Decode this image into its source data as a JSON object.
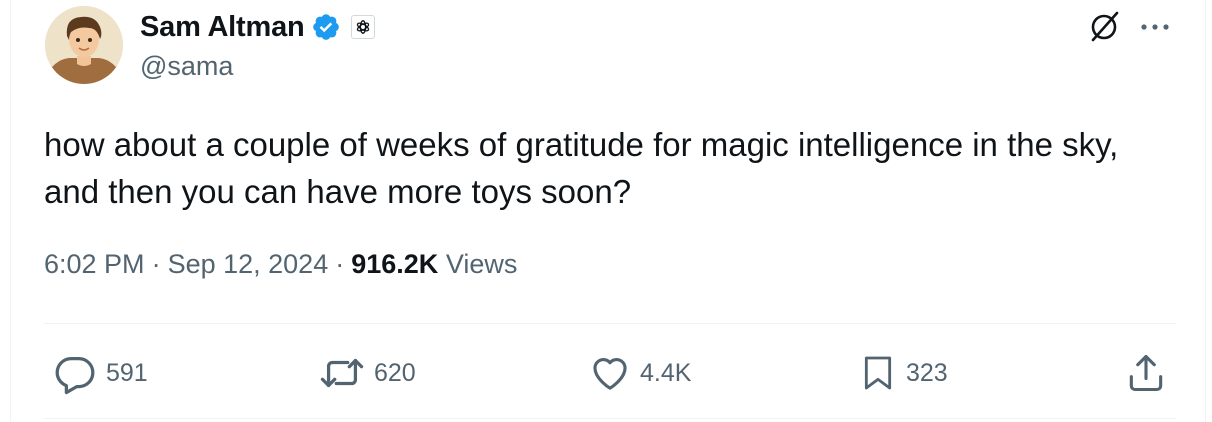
{
  "author": {
    "display_name": "Sam Altman",
    "handle": "@sama",
    "verified_icon": "verified-badge-icon",
    "affiliation_icon": "openai-logo-icon",
    "avatar": "avatar"
  },
  "header_actions": {
    "grok_icon": "grok-icon",
    "more_icon": "more-dots-icon"
  },
  "tweet": {
    "text": "how about a couple of weeks of gratitude for magic intelligence in the sky, and then you can have more toys soon?"
  },
  "meta": {
    "time": "6:02 PM",
    "separator": "·",
    "date": "Sep 12, 2024",
    "views_count": "916.2K",
    "views_label": "Views"
  },
  "actions": {
    "replies": "591",
    "reposts": "620",
    "likes": "4.4K",
    "bookmarks": "323"
  },
  "colors": {
    "text": "#0f1419",
    "secondary": "#536471",
    "verified": "#1d9bf0",
    "divider": "#eff3f4"
  }
}
